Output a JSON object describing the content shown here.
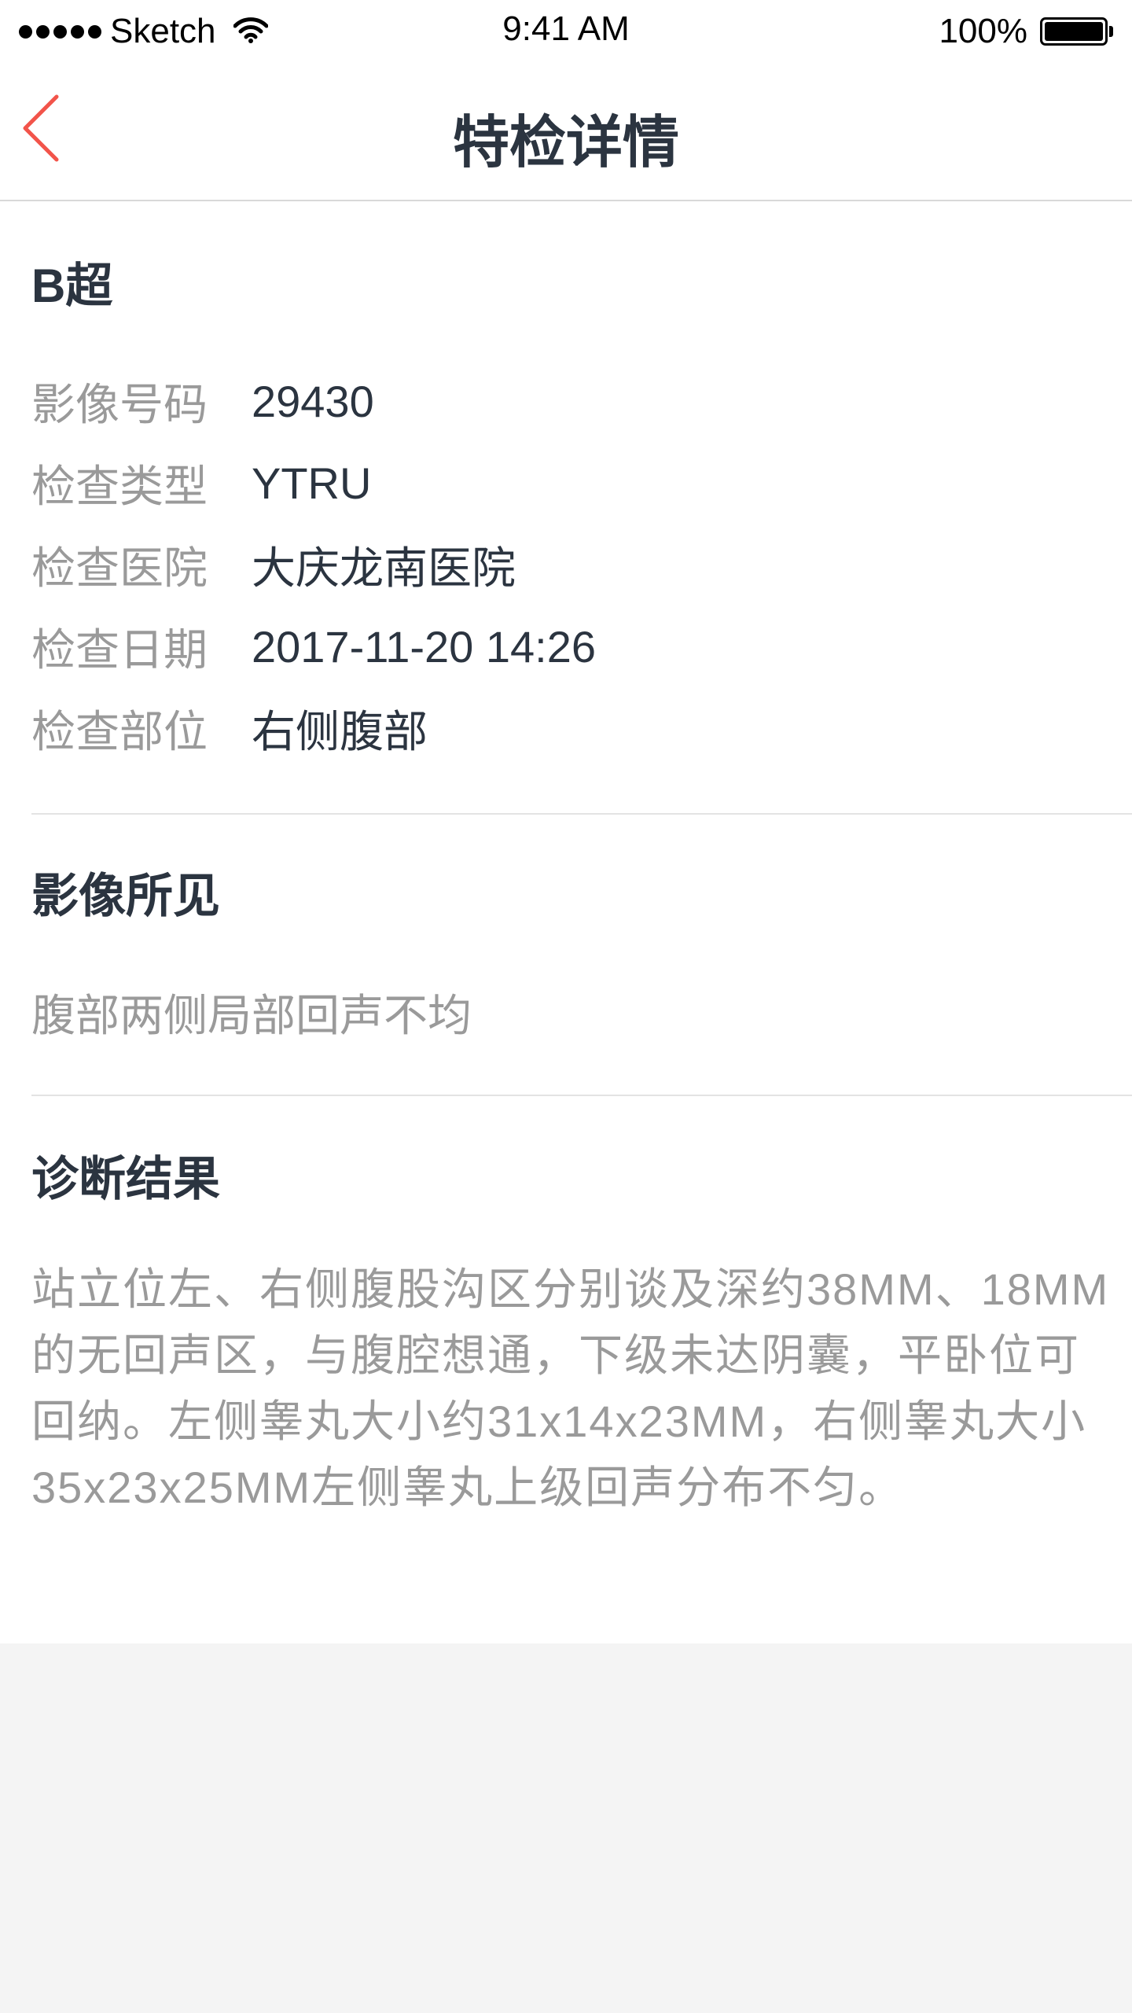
{
  "status_bar": {
    "carrier": "Sketch",
    "time": "9:41 AM",
    "battery": "100%",
    "battery_level": 1.0
  },
  "nav": {
    "title": "特检详情"
  },
  "exam": {
    "type_title": "B超",
    "rows": [
      {
        "label": "影像号码",
        "value": "29430"
      },
      {
        "label": "检查类型",
        "value": "YTRU"
      },
      {
        "label": "检查医院",
        "value": "大庆龙南医院"
      },
      {
        "label": "检查日期",
        "value": "2017-11-20 14:26"
      },
      {
        "label": "检查部位",
        "value": "右侧腹部"
      }
    ]
  },
  "findings": {
    "title": "影像所见",
    "text": "腹部两侧局部回声不均"
  },
  "diagnosis": {
    "title": "诊断结果",
    "text": "站立位左、右侧腹股沟区分别谈及深约38MM、18MM的无回声区，与腹腔想通，下级未达阴囊，平卧位可回纳。左侧睾丸大小约31x14x23MM，右侧睾丸大小35x23x25MM左侧睾丸上级回声分布不匀。"
  },
  "colors": {
    "accent": "#f2544a",
    "title_text": "#2b3440",
    "label_text": "#9a9a9a",
    "page_bg": "#f4f4f4"
  }
}
